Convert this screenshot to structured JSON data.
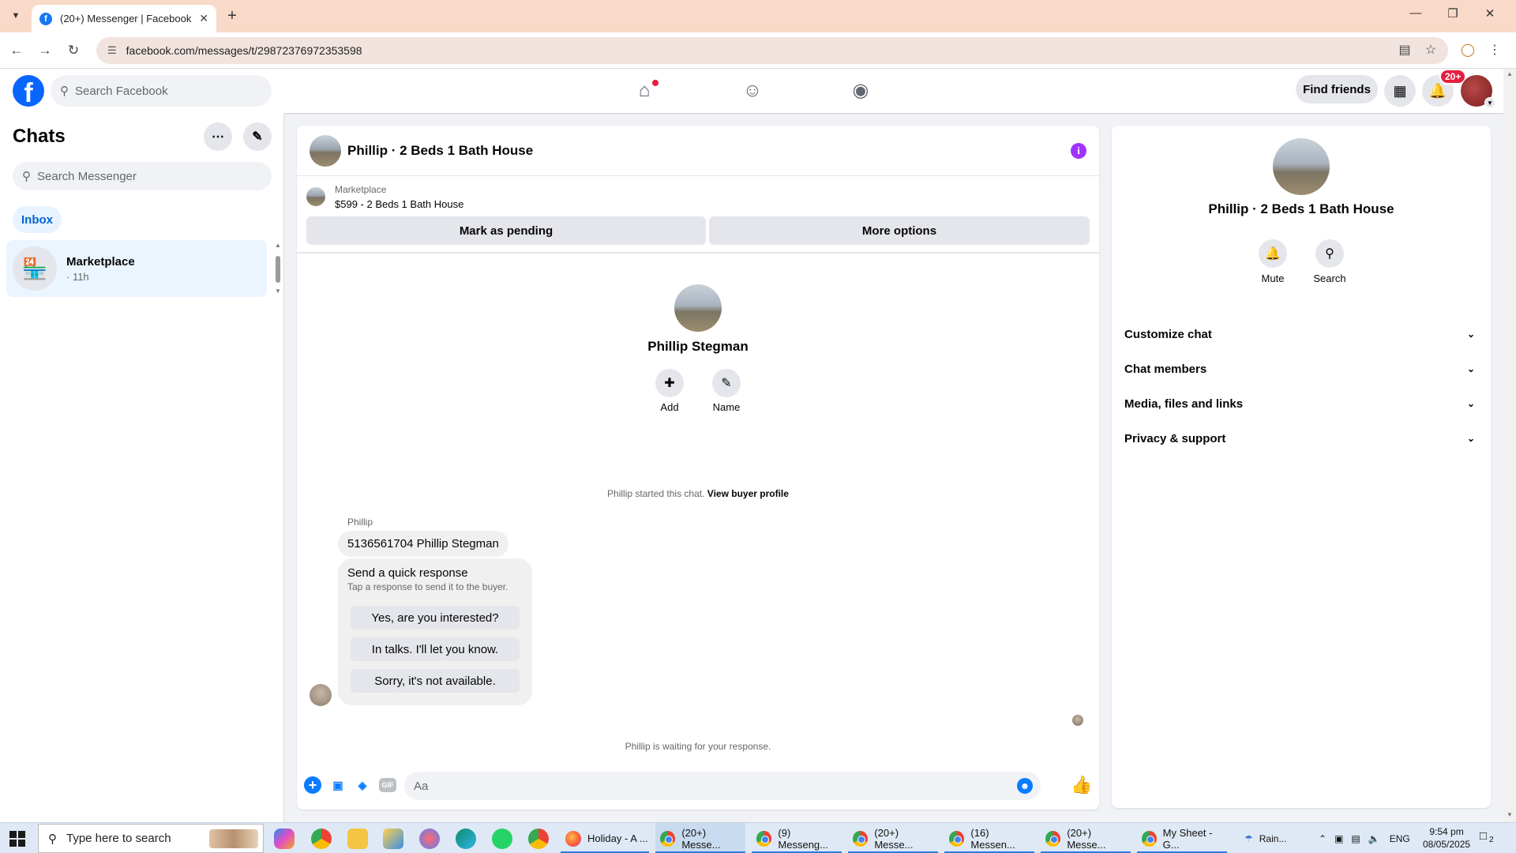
{
  "browser": {
    "tab_title": "(20+) Messenger | Facebook",
    "url": "facebook.com/messages/t/29872376972353598"
  },
  "fb_header": {
    "search_placeholder": "Search Facebook",
    "find_friends": "Find friends",
    "notification_badge": "20+"
  },
  "sidebar": {
    "title": "Chats",
    "search_placeholder": "Search Messenger",
    "filter": "Inbox",
    "chats": [
      {
        "name": "Marketplace",
        "time": "· 11h"
      }
    ]
  },
  "conversation": {
    "title": "Phillip · 2 Beds 1 Bath House",
    "marketplace_label": "Marketplace",
    "listing": "$599 - 2 Beds 1 Bath House",
    "mark_pending": "Mark as pending",
    "more_options": "More options",
    "profile_name": "Phillip Stegman",
    "add_label": "Add",
    "name_label": "Name",
    "started_text": "Phillip started this chat.",
    "view_buyer_profile": "View buyer profile",
    "sender_name": "Phillip",
    "message": "5136561704 Phillip Stegman",
    "quick_title": "Send a quick response",
    "quick_subtitle": "Tap a response to send it to the buyer.",
    "quick_responses": [
      "Yes, are you interested?",
      "In talks. I'll let you know.",
      "Sorry, it's not available."
    ],
    "waiting_text": "Phillip is waiting for your response.",
    "composer_placeholder": "Aa",
    "gif_label": "GIF"
  },
  "right_panel": {
    "name": "Phillip · 2 Beds 1 Bath House",
    "mute": "Mute",
    "search": "Search",
    "sections": [
      "Customize chat",
      "Chat members",
      "Media, files and links",
      "Privacy & support"
    ]
  },
  "taskbar": {
    "search_placeholder": "Type here to search",
    "apps": [
      "Holiday - A ...",
      "(20+) Messe...",
      "(9) Messeng...",
      "(20+) Messe...",
      "(16) Messen...",
      "(20+) Messe...",
      "My Sheet - G..."
    ],
    "weather": "Rain...",
    "language": "ENG",
    "time": "9:54 pm",
    "date": "08/05/2025",
    "notifications": "2"
  },
  "colors": {
    "fb_blue": "#0866ff",
    "messenger_blue": "#0a7cff",
    "info_purple": "#a033ff",
    "tab_strip": "#f9d9c8",
    "notification_red": "#e41e3f"
  }
}
